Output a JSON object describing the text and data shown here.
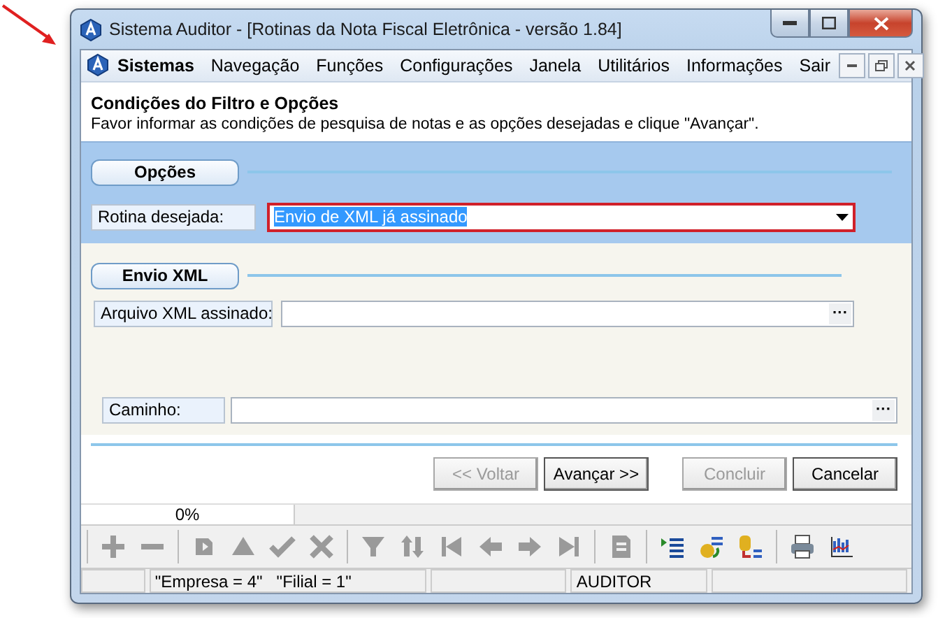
{
  "window": {
    "title": "Sistema Auditor - [Rotinas da Nota Fiscal Eletrônica - versão 1.84]"
  },
  "menu": [
    {
      "label": "Sistemas",
      "bold": true
    },
    {
      "label": "Navegação",
      "bold": false
    },
    {
      "label": "Funções",
      "bold": false
    },
    {
      "label": "Configurações",
      "bold": false
    },
    {
      "label": "Janela",
      "bold": false
    },
    {
      "label": "Utilitários",
      "bold": false
    },
    {
      "label": "Informações",
      "bold": false
    },
    {
      "label": "Sair",
      "bold": false
    }
  ],
  "header": {
    "title": "Condições do Filtro e Opções",
    "subtitle": "Favor informar as condições de pesquisa de notas e as opções desejadas e clique \"Avançar\"."
  },
  "options": {
    "heading": "Opções",
    "label": "Rotina desejada:",
    "value": "Envio de XML já assinado"
  },
  "xml": {
    "heading": "Envio XML",
    "label": "Arquivo XML assinado:",
    "button": "···"
  },
  "path": {
    "label": "Caminho:",
    "button": "···"
  },
  "buttons": [
    {
      "label": "<< Voltar",
      "disabled": true
    },
    {
      "label": "Avançar >>",
      "disabled": false
    },
    {
      "label": "Concluir",
      "disabled": true
    },
    {
      "label": "Cancelar",
      "disabled": false
    }
  ],
  "progress": {
    "reading": "0%",
    "level": 0
  },
  "toolbar": [
    [
      {
        "kind": "plus",
        "disabled": true
      },
      {
        "kind": "minus",
        "disabled": true
      }
    ],
    [
      {
        "kind": "refresh",
        "disabled": true
      },
      {
        "kind": "up",
        "disabled": true
      },
      {
        "kind": "check",
        "disabled": true
      },
      {
        "kind": "cross",
        "disabled": true
      }
    ],
    [
      {
        "kind": "funnel",
        "disabled": true
      },
      {
        "kind": "sort",
        "disabled": true
      },
      {
        "kind": "first",
        "disabled": true
      },
      {
        "kind": "prev",
        "disabled": true
      },
      {
        "kind": "next",
        "disabled": true
      },
      {
        "kind": "last",
        "disabled": true
      }
    ],
    [
      {
        "kind": "document",
        "disabled": true
      }
    ],
    [
      {
        "kind": "list",
        "disabled": false
      },
      {
        "kind": "transfer",
        "disabled": false
      },
      {
        "kind": "dblist",
        "disabled": false
      }
    ],
    [
      {
        "kind": "printer",
        "disabled": false
      },
      {
        "kind": "chart",
        "disabled": false
      }
    ]
  ],
  "status_bar": [
    {
      "text": "\"Empresa = 4\"   \"Filial = 1\""
    },
    {
      "text": "AUDITOR"
    }
  ]
}
